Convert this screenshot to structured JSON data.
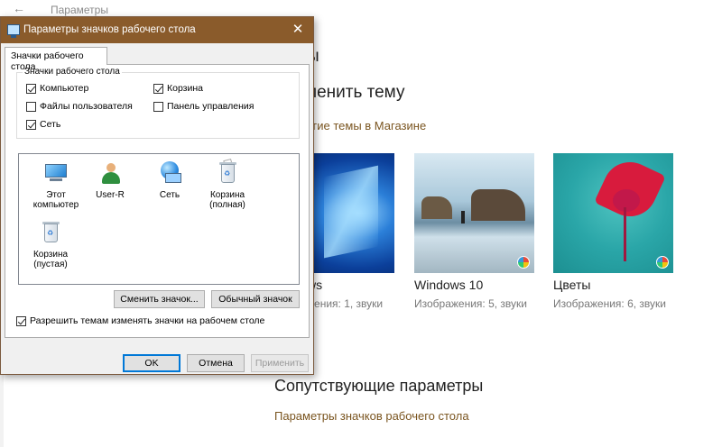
{
  "background_window": {
    "title": "Параметры",
    "heading_truncated": "ы",
    "apply_theme_heading": "менить тему",
    "store_link": "угие темы в Магазине",
    "themes": [
      {
        "name": "ws",
        "meta": "жения: 1, звуки"
      },
      {
        "name": "Windows 10",
        "meta": "Изображения: 5, звуки"
      },
      {
        "name": "Цветы",
        "meta": "Изображения: 6, звуки"
      }
    ],
    "related_heading": "Сопутствующие параметры",
    "related_link": "Параметры значков рабочего стола"
  },
  "dialog": {
    "title": "Параметры значков рабочего стола",
    "close_glyph": "✕",
    "tab_label": "Значки рабочего стола",
    "group_label": "Значки рабочего стола",
    "checkboxes": [
      {
        "label": "Компьютер",
        "checked": true
      },
      {
        "label": "Корзина",
        "checked": true
      },
      {
        "label": "Файлы пользователя",
        "checked": false
      },
      {
        "label": "Панель управления",
        "checked": false
      },
      {
        "label": "Сеть",
        "checked": true
      }
    ],
    "icons": [
      {
        "label": "Этот компьютер",
        "icon": "computer-icon"
      },
      {
        "label": "User-R",
        "icon": "user-folder-icon"
      },
      {
        "label": "Сеть",
        "icon": "network-icon"
      },
      {
        "label": "Корзина (полная)",
        "icon": "recycle-bin-full-icon"
      },
      {
        "label": "Корзина (пустая)",
        "icon": "recycle-bin-empty-icon"
      }
    ],
    "change_icon_button": "Сменить значок...",
    "default_icon_button": "Обычный значок",
    "allow_themes_label": "Разрешить темам изменять значки на рабочем столе",
    "allow_themes_checked": true,
    "ok_button": "OK",
    "cancel_button": "Отмена",
    "apply_button": "Применить"
  },
  "colors": {
    "dialog_titlebar": "#8a5b2b",
    "link": "#7a5520",
    "primary_button_border": "#0078d7"
  }
}
